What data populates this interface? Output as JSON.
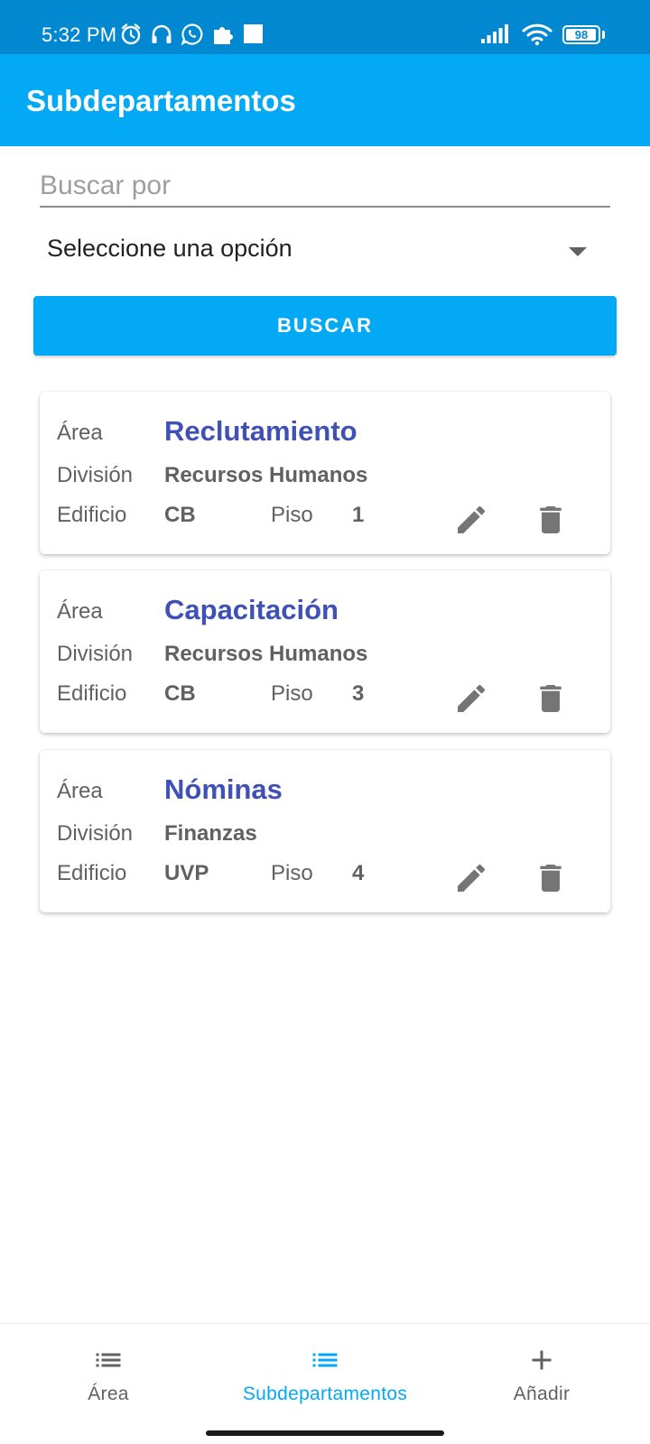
{
  "status_bar": {
    "time": "5:32 PM",
    "battery": "98",
    "battery_level": 0.98,
    "icons": [
      "alarm-icon",
      "headphones-icon",
      "whatsapp-icon",
      "puzzle-icon",
      "square-notification-icon",
      "signal-icon",
      "wifi-icon",
      "battery-icon"
    ]
  },
  "app_bar": {
    "title": "Subdepartamentos"
  },
  "search": {
    "placeholder": "Buscar por",
    "value": ""
  },
  "filter": {
    "selected": "Seleccione una opción"
  },
  "search_button": {
    "label": "BUSCAR"
  },
  "labels": {
    "area": "Área",
    "division": "División",
    "building": "Edificio",
    "floor": "Piso"
  },
  "cards": [
    {
      "area": "Reclutamiento",
      "division": "Recursos Humanos",
      "building": "CB",
      "floor": "1"
    },
    {
      "area": "Capacitación",
      "division": "Recursos Humanos",
      "building": "CB",
      "floor": "3"
    },
    {
      "area": "Nóminas",
      "division": "Finanzas",
      "building": "UVP",
      "floor": "4"
    }
  ],
  "bottom_nav": {
    "items": [
      {
        "label": "Área",
        "icon": "list-icon",
        "active": false
      },
      {
        "label": "Subdepartamentos",
        "icon": "list-icon",
        "active": true
      },
      {
        "label": "Añadir",
        "icon": "plus-icon",
        "active": false
      }
    ]
  },
  "colors": {
    "status_bar": "#0288d1",
    "app_bar": "#03a9f4",
    "accent": "#03a9f4",
    "card_title": "#3f51b5",
    "icon_gray": "#757575"
  }
}
